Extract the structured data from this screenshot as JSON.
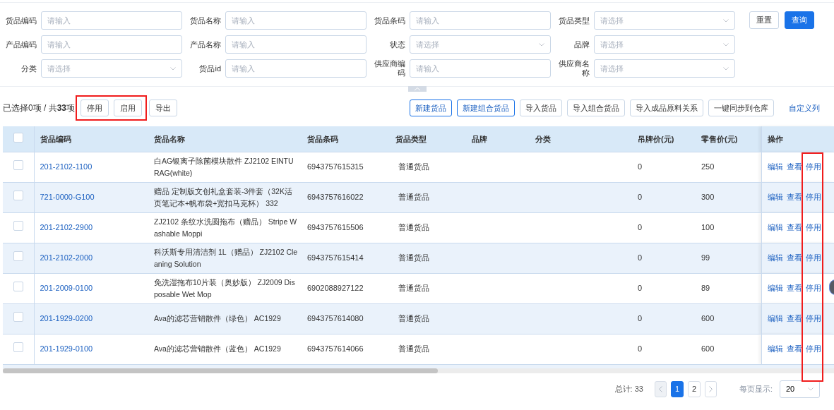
{
  "filters": [
    {
      "label": "货品编码",
      "kind": "input",
      "placeholder": "请输入"
    },
    {
      "label": "货品名称",
      "kind": "input",
      "placeholder": "请输入"
    },
    {
      "label": "货品条码",
      "kind": "input",
      "placeholder": "请输入"
    },
    {
      "label": "货品类型",
      "kind": "select",
      "placeholder": "请选择"
    },
    {
      "label": "产品编码",
      "kind": "input",
      "placeholder": "请输入"
    },
    {
      "label": "产品名称",
      "kind": "input",
      "placeholder": "请输入"
    },
    {
      "label": "状态",
      "kind": "select",
      "placeholder": "请选择"
    },
    {
      "label": "品牌",
      "kind": "select",
      "placeholder": "请选择"
    },
    {
      "label": "分类",
      "kind": "select",
      "placeholder": "请选择"
    },
    {
      "label": "货品id",
      "kind": "input",
      "placeholder": "请输入"
    },
    {
      "label": "供应商编码",
      "kind": "input",
      "placeholder": "请输入"
    },
    {
      "label": "供应商名称",
      "kind": "select",
      "placeholder": "请选择"
    }
  ],
  "filter_buttons": [
    {
      "label": "重置",
      "kind": "default"
    },
    {
      "label": "查询",
      "kind": "primary"
    }
  ],
  "selection_summary": "已选择0项 / 共**33**项",
  "bulk_actions": [
    "停用",
    "启用"
  ],
  "export_button": "导出",
  "toolbar_actions": [
    {
      "label": "新建货品",
      "kind": "outline"
    },
    {
      "label": "新建组合货品",
      "kind": "outline"
    },
    {
      "label": "导入货品",
      "kind": "default"
    },
    {
      "label": "导入组合货品",
      "kind": "default"
    },
    {
      "label": "导入成品原料关系",
      "kind": "default"
    },
    {
      "label": "一键同步到仓库",
      "kind": "default"
    }
  ],
  "customize_columns_link": "自定义列",
  "table": {
    "select_all_checked": false,
    "columns": [
      "货品编码",
      "货品名称",
      "货品条码",
      "货品类型",
      "品牌",
      "分类",
      "吊牌价(元)",
      "零售价(元)",
      "操作"
    ],
    "rows": [
      {
        "checked": false,
        "code": "201-2102-1100",
        "name": "白AG银离子除菌模块散件 ZJ2102 EINTURAG(white)",
        "barcode": "6943757615315",
        "type": "普通货品",
        "tag_price": "0",
        "retail_price": "250",
        "actions": [
          "编辑",
          "查看",
          "停用"
        ]
      },
      {
        "checked": false,
        "code": "721-0000-G100",
        "name": "赠品 定制版文创礼盒套装-3件套（32K活页笔记本+帆布袋+宽扣马克杯） 332",
        "barcode": "6943757616022",
        "type": "普通货品",
        "tag_price": "0",
        "retail_price": "300",
        "actions": [
          "编辑",
          "查看",
          "停用"
        ]
      },
      {
        "checked": false,
        "code": "201-2102-2900",
        "name": "ZJ2102 条纹水洗圆拖布（赠品） Stripe Washable Moppi",
        "barcode": "6943757615506",
        "type": "普通货品",
        "tag_price": "0",
        "retail_price": "100",
        "actions": [
          "编辑",
          "查看",
          "停用"
        ]
      },
      {
        "checked": false,
        "code": "201-2102-2000",
        "name": "科沃斯专用清洁剂 1L（赠品） ZJ2102 Cleaning Solution",
        "barcode": "6943757615414",
        "type": "普通货品",
        "tag_price": "0",
        "retail_price": "99",
        "actions": [
          "编辑",
          "查看",
          "停用"
        ]
      },
      {
        "checked": false,
        "code": "201-2009-0100",
        "name": "免洗湿拖布10片装（奥妙版） ZJ2009 Disposable Wet Mop",
        "barcode": "6902088927122",
        "type": "普通货品",
        "tag_price": "0",
        "retail_price": "89",
        "actions": [
          "编辑",
          "查看",
          "停用"
        ]
      },
      {
        "checked": false,
        "code": "201-1929-0200",
        "name": "Ava的滤芯营销散件（绿色） AC1929",
        "barcode": "6943757614080",
        "type": "普通货品",
        "tag_price": "0",
        "retail_price": "600",
        "actions": [
          "编辑",
          "查看",
          "停用"
        ]
      },
      {
        "checked": false,
        "code": "201-1929-0100",
        "name": "Ava的滤芯营销散件（蓝色） AC1929",
        "barcode": "6943757614066",
        "type": "普通货品",
        "tag_price": "0",
        "retail_price": "600",
        "actions": [
          "编辑",
          "查看",
          "停用"
        ]
      }
    ]
  },
  "pagination": {
    "total": "总计: 33",
    "pages": [
      {
        "label": "1",
        "selected": true
      },
      {
        "label": "2",
        "selected": false
      }
    ],
    "page_size_label": "每页显示:",
    "page_size": "20"
  }
}
